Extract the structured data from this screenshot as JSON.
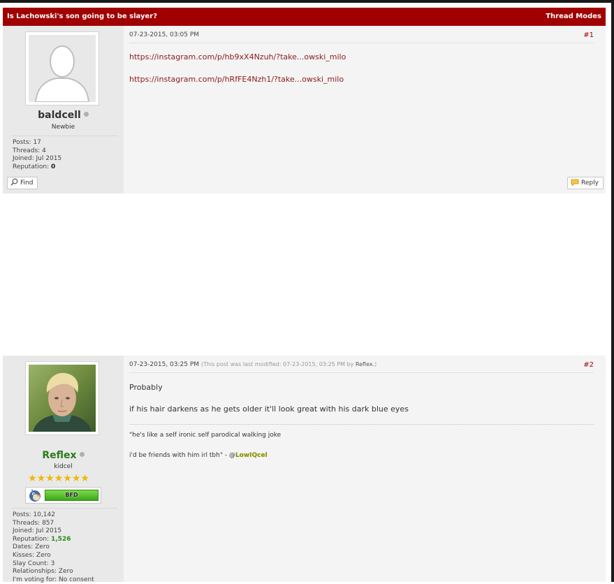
{
  "thread": {
    "title": "Is Lachowski's son going to be slayer?",
    "modes_label": "Thread Modes"
  },
  "posts": [
    {
      "username": "baldcell",
      "user_title": "Newbie",
      "stats": {
        "posts_label": "Posts:",
        "posts": "17",
        "threads_label": "Threads:",
        "threads": "4",
        "joined_label": "Joined:",
        "joined": "Jul 2015",
        "reputation_label": "Reputation:",
        "reputation": "0"
      },
      "find_label": "Find",
      "reply_label": "Reply",
      "date": "07-23-2015, 03:05 PM",
      "number": "#1",
      "links": [
        "https://instagram.com/p/hb9xX4Nzuh/?take...owski_milo",
        "https://instagram.com/p/hRfFE4Nzh1/?take...owski_milo"
      ]
    },
    {
      "username": "Reflex",
      "username_color": "#2a7a1a",
      "user_title": "kidcel",
      "star_count": 7,
      "rank_label": "BFD",
      "stats": {
        "posts_label": "Posts:",
        "posts": "10,142",
        "threads_label": "Threads:",
        "threads": "857",
        "joined_label": "Joined:",
        "joined": "Jul 2015",
        "reputation_label": "Reputation:",
        "reputation": "1,526",
        "dates_label": "Dates:",
        "dates": "Zero",
        "kisses_label": "Kisses:",
        "kisses": "Zero",
        "slay_label": "Slay Count:",
        "slay": "3",
        "relationships_label": "Relationships:",
        "relationships": "Zero",
        "voting_label": "I'm voting for:",
        "voting": "No consent"
      },
      "date": "07-23-2015, 03:25 PM",
      "edited_prefix": "(This post was last modified: 07-23-2015, 03:25 PM by",
      "edited_by": "Reflex.",
      "edited_suffix": ")",
      "number": "#2",
      "body": [
        "Probably",
        "if his hair darkens as he gets older it'll look great with his dark blue eyes"
      ],
      "signature": {
        "line1": "\"he's like a self ironic self parodical walking joke",
        "line2_prefix": "i'd be friends with him irl tbh\" - @",
        "mention": "LowIQcel"
      }
    }
  ]
}
